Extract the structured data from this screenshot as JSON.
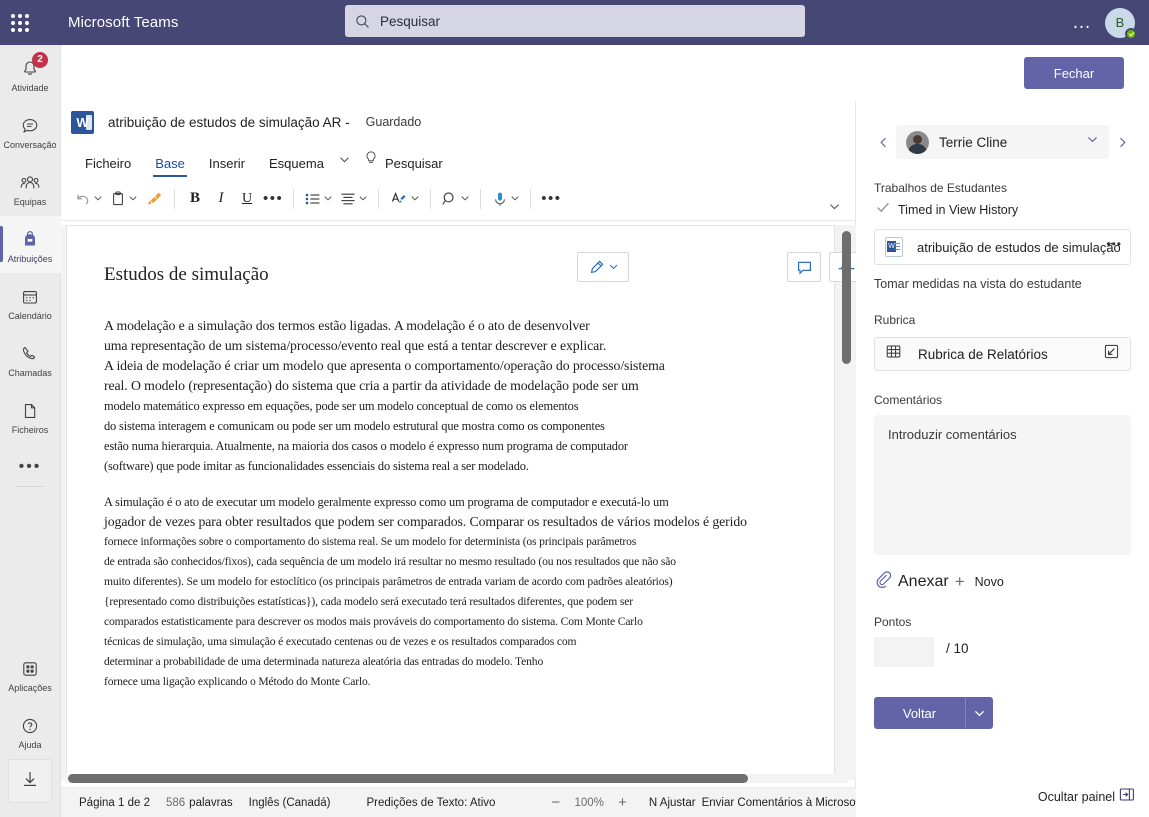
{
  "topbar": {
    "app_title": "Microsoft Teams",
    "search_placeholder": "Pesquisar",
    "more_label": "…",
    "avatar_initial": "B"
  },
  "rail": {
    "items": [
      {
        "label": "Atividade",
        "icon": "bell-icon",
        "badge": "2"
      },
      {
        "label": "Conversação",
        "icon": "chat-icon",
        "badge": ""
      },
      {
        "label": "Equipas",
        "icon": "people-icon",
        "badge": ""
      },
      {
        "label": "Atribuições",
        "icon": "backpack-icon",
        "badge": ""
      },
      {
        "label": "Calendário",
        "icon": "calendar-icon",
        "badge": ""
      },
      {
        "label": "Chamadas",
        "icon": "phone-icon",
        "badge": ""
      },
      {
        "label": "Ficheiros",
        "icon": "file-icon",
        "badge": ""
      }
    ],
    "more_label": "•••",
    "bottom": [
      {
        "label": "Aplicações",
        "icon": "apps-icon"
      },
      {
        "label": "Ajuda",
        "icon": "help-icon"
      }
    ],
    "download_icon": "download-icon"
  },
  "close_button": "Fechar",
  "word": {
    "doc_name": "atribuição de estudos de simulação AR -",
    "saved_status": "Guardado",
    "tabs": [
      {
        "label": "Ficheiro",
        "selected": false
      },
      {
        "label": "Base",
        "selected": true
      },
      {
        "label": "Inserir",
        "selected": false
      },
      {
        "label": "Esquema",
        "selected": false
      }
    ],
    "tabs_caret": "chevron-down-icon",
    "bulb_icon": "lightbulb-icon",
    "search_label": "Pesquisar",
    "toolbar": [
      {
        "name": "undo-button",
        "icon": "undo-icon",
        "caret": true
      },
      {
        "name": "paste-button",
        "icon": "clipboard-icon",
        "caret": true
      },
      {
        "name": "format-painter-button",
        "icon": "brush-icon",
        "caret": false
      },
      {
        "name": "bold-button",
        "icon": "bold-icon",
        "caret": false
      },
      {
        "name": "italic-button",
        "icon": "italic-icon",
        "caret": false
      },
      {
        "name": "underline-button",
        "icon": "underline-icon",
        "caret": false
      },
      {
        "name": "font-more-button",
        "icon": "ellipsis-icon",
        "caret": false
      },
      {
        "name": "bullet-list-button",
        "icon": "bullet-list-icon",
        "caret": true
      },
      {
        "name": "align-button",
        "icon": "align-icon",
        "caret": true
      },
      {
        "name": "text-styles-button",
        "icon": "text-style-icon",
        "caret": true
      },
      {
        "name": "find-button",
        "icon": "search-icon",
        "caret": true
      },
      {
        "name": "dictate-button",
        "icon": "microphone-icon",
        "caret": true
      },
      {
        "name": "toolbar-more-button",
        "icon": "ellipsis-icon",
        "caret": false
      }
    ],
    "editing_mode_icon": "pencil-icon",
    "comment_icon": "comment-icon",
    "activity_icon": "activity-icon",
    "more_icon": "ellipsis-icon",
    "collapse_ribbon_icon": "chevron-down-icon",
    "document": {
      "heading": "Estudos de simulação",
      "paragraph1": [
        "A modelação e a simulação dos termos estão ligadas. A modelação é o ato de desenvolver",
        "uma representação de um sistema/processo/evento real que está a tentar descrever e explicar.",
        "A ideia de modelação é criar um modelo que apresenta o comportamento/operação do processo/sistema",
        "real. O modelo (representação) do sistema que cria a partir da atividade de modelação pode ser um",
        "modelo matemático expresso em equações, pode ser um modelo conceptual de como os elementos",
        "do sistema interagem e comunicam ou pode ser um modelo estrutural que mostra como os componentes",
        "estão numa hierarquia. Atualmente, na maioria dos casos o modelo é expresso num programa de computador",
        "(software) que pode imitar as funcionalidades essenciais do sistema real a ser modelado."
      ],
      "paragraph2": [
        "A simulação é o ato de executar um modelo geralmente expresso como um programa de computador e executá-lo um",
        "jogador de vezes para obter resultados que podem ser comparados. Comparar os resultados de vários modelos é gerido",
        "fornece informações sobre o comportamento do sistema real. Se um modelo for determinista (os principais parâmetros",
        "de entrada são conhecidos/fixos), cada sequência de um modelo irá resultar no mesmo resultado (ou nos resultados que não são",
        "muito diferentes). Se um modelo for estoclítico (os principais parâmetros de entrada variam de acordo com padrões aleatórios)",
        "{representado como distribuições estatísticas}), cada modelo será executado terá resultados diferentes, que podem ser",
        "comparados estatisticamente para descrever os modos mais prováveis do comportamento do sistema. Com Monte Carlo",
        "técnicas de simulação, uma simulação é executado centenas ou de vezes e os resultados comparados com",
        "determinar a probabilidade de uma determinada natureza aleatória das entradas do modelo. Tenho",
        "fornece uma ligação explicando o Método do Monte Carlo."
      ]
    },
    "statusbar": {
      "page": "Página 1 de 2",
      "word_count": "586",
      "words_label": "palavras",
      "language": "Inglês (Canadá)",
      "predictions": "Predições de Texto: Ativo",
      "zoom_out": "−",
      "zoom_value": "100%",
      "zoom_in": "+",
      "fit": "N Ajustar",
      "feedback": "Enviar Comentários à Microsoft"
    }
  },
  "panel": {
    "prev_icon": "chevron-left-icon",
    "next_icon": "chevron-right-icon",
    "student_name": "Terrie Cline",
    "student_caret": "chevron-down-icon",
    "student_work_label": "Trabalhos de Estudantes",
    "timed_status": "Timed in View History",
    "timed_icon": "checkmark-icon",
    "file_name": "atribuição de estudos de simulação",
    "file_more": "•••",
    "take_action_hint": "Tomar medidas na vista do estudante",
    "rubric_label": "Rubrica",
    "rubric_name": "Rubrica de Relatórios",
    "rubric_icon": "grid-icon",
    "rubric_expand_icon": "expand-icon",
    "comments_label": "Comentários",
    "comments_placeholder": "Introduzir comentários",
    "comments_value": "",
    "attach_label": "Anexar",
    "attach_icon": "paperclip-icon",
    "plus_icon": "plus-icon",
    "new_label": "Novo",
    "points_label": "Pontos",
    "points_value": "",
    "points_max": "/ 10",
    "back_button": "Voltar",
    "back_caret": "chevron-down-icon",
    "hide_panel_label": "Ocultar painel",
    "hide_panel_icon": "panel-collapse-icon"
  },
  "colors": {
    "teams_purple": "#464775",
    "accent": "#6264a7",
    "badge_red": "#c4314b",
    "word_blue": "#2b579a",
    "presence_green": "#6bb700"
  }
}
